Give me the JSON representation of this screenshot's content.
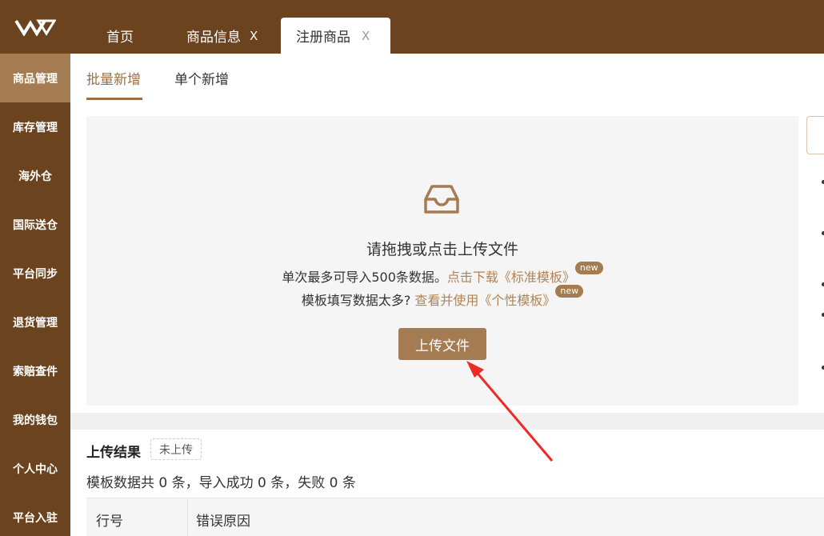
{
  "header": {
    "tabs": [
      {
        "label": "首页",
        "closable": false
      },
      {
        "label": "商品信息",
        "closable": true
      },
      {
        "label": "注册商品",
        "closable": true,
        "active": true
      }
    ],
    "close_glyph": "X"
  },
  "sidebar": {
    "items": [
      {
        "label": "商品管理",
        "active": true
      },
      {
        "label": "库存管理"
      },
      {
        "label": "海外仓"
      },
      {
        "label": "国际送仓"
      },
      {
        "label": "平台同步"
      },
      {
        "label": "退货管理"
      },
      {
        "label": "索赔查件"
      },
      {
        "label": "我的钱包"
      },
      {
        "label": "个人中心"
      },
      {
        "label": "平台入驻"
      }
    ]
  },
  "subtabs": {
    "batch": "批量新增",
    "single": "单个新增"
  },
  "upload": {
    "title": "请拖拽或点击上传文件",
    "line1_text": "单次最多可导入500条数据。",
    "line1_link": "点击下载《标准模板》",
    "line2_text": "模板填写数据太多?",
    "line2_link": "查看并使用《个性模板》",
    "badge": "new",
    "button": "上传文件"
  },
  "result": {
    "title": "上传结果",
    "status": "未上传",
    "summary": "模板数据共 0 条，导入成功 0 条，失败 0 条",
    "columns": [
      "行号",
      "错误原因"
    ]
  },
  "icons": {
    "logo": "brand-logo-icon",
    "upload": "inbox-icon",
    "annotation": "red-arrow"
  },
  "colors": {
    "brand_dark": "#6b431e",
    "brand_accent": "#a57c52",
    "link": "#b08457",
    "arrow": "#ee2a24"
  }
}
